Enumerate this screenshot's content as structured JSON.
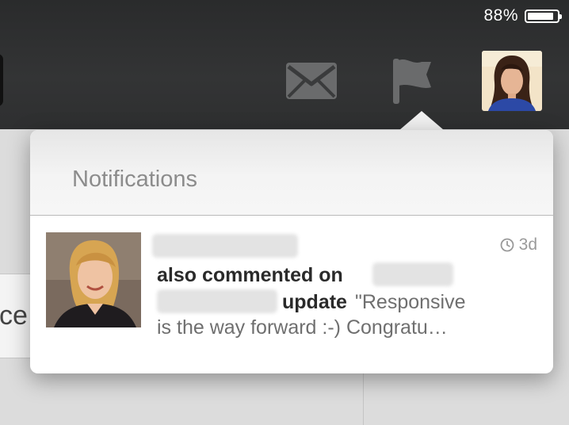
{
  "status_bar": {
    "battery_percent_label": "88%",
    "battery_level": 0.88
  },
  "nav": {
    "icons": [
      "mail-icon",
      "flag-icon",
      "user-avatar"
    ]
  },
  "background": {
    "partial_text": "ce l"
  },
  "popover": {
    "title": "Notifications",
    "items": [
      {
        "time": "3d",
        "action_line1": "also commented on",
        "action_word": "update",
        "excerpt_line1": "\"Responsive",
        "excerpt_line2": "is the way forward :-) Congratu…"
      }
    ]
  },
  "colors": {
    "topbar": "#333435",
    "title_grey": "#8c8c8c",
    "text_dark": "#2a2a2a"
  }
}
